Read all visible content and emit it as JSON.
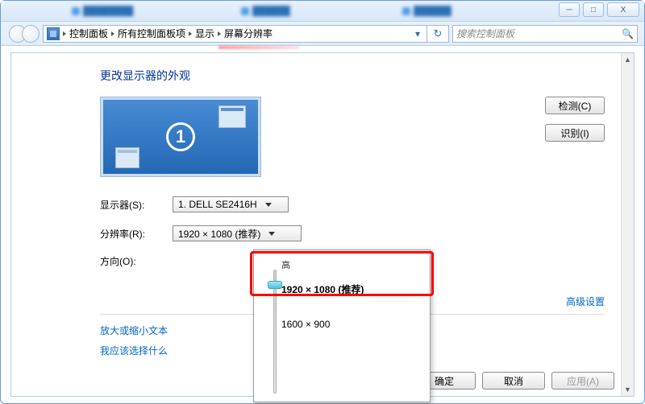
{
  "window": {
    "minimize": "─",
    "maximize": "□",
    "close": "X"
  },
  "breadcrumb": {
    "items": [
      "控制面板",
      "所有控制面板项",
      "显示",
      "屏幕分辨率"
    ]
  },
  "search": {
    "placeholder": "搜索控制面板"
  },
  "page": {
    "title": "更改显示器的外观",
    "monitor_number": "1",
    "detect_btn": "检测(C)",
    "identify_btn": "识别(I)"
  },
  "form": {
    "display_label": "显示器(S):",
    "display_value": "1. DELL SE2416H",
    "resolution_label": "分辨率(R):",
    "resolution_value": "1920 × 1080 (推荐)",
    "orientation_label": "方向(O):"
  },
  "res_popup": {
    "high": "高",
    "opt1": "1920 × 1080 (推荐)",
    "opt2": "1600 × 900"
  },
  "links": {
    "advanced": "高级设置",
    "magnify": "放大或缩小文本",
    "help": "我应该选择什么"
  },
  "footer": {
    "ok": "确定",
    "cancel": "取消",
    "apply": "应用(A)"
  }
}
